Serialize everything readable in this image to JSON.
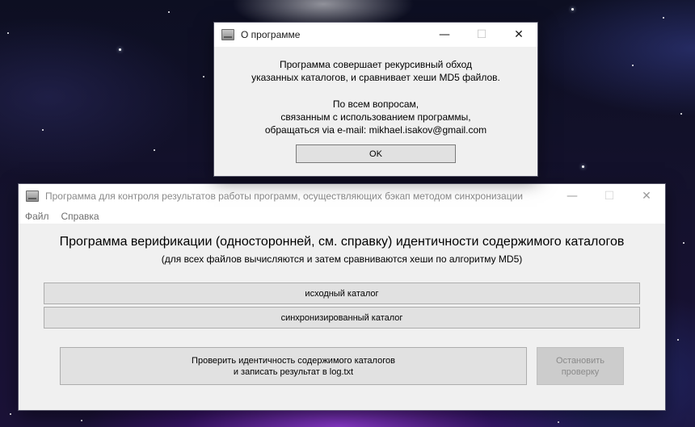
{
  "about_dialog": {
    "title": "О программе",
    "lines": [
      "Программа совершает рекурсивный обход",
      "указанных каталогов, и сравнивает хеши MD5 файлов.",
      "По всем вопросам,",
      "связанным с использованием программы,",
      "обращаться via e-mail: mikhael.isakov@gmail.com"
    ],
    "ok_label": "OK"
  },
  "main_window": {
    "title": "Программа для контроля результатов работы программ, осуществляющих бэкап методом синхронизации",
    "menu": [
      "Файл",
      "Справка"
    ],
    "heading": "Программа верификации (односторонней, см. справку) идентичности содержимого каталогов",
    "subheading": "(для всех файлов вычисляются и затем сравниваются хеши по алгоритму MD5)",
    "source_dir_label": "исходный каталог",
    "synced_dir_label": "синхронизированный каталог",
    "verify_label_line1": "Проверить идентичность содержимого каталогов",
    "verify_label_line2": "и записать результат в log.txt",
    "stop_label_line1": "Остановить",
    "stop_label_line2": "проверку"
  },
  "caption_glyphs": {
    "minimize": "—",
    "maximize": "☐",
    "close": "✕"
  },
  "colors": {
    "window_bg": "#f0f0f0",
    "button_bg": "#e1e1e1",
    "button_border": "#adadad",
    "disabled_text": "#8a8a8a"
  },
  "icons": [
    "app-icon",
    "minimize-icon",
    "maximize-icon",
    "close-icon"
  ]
}
